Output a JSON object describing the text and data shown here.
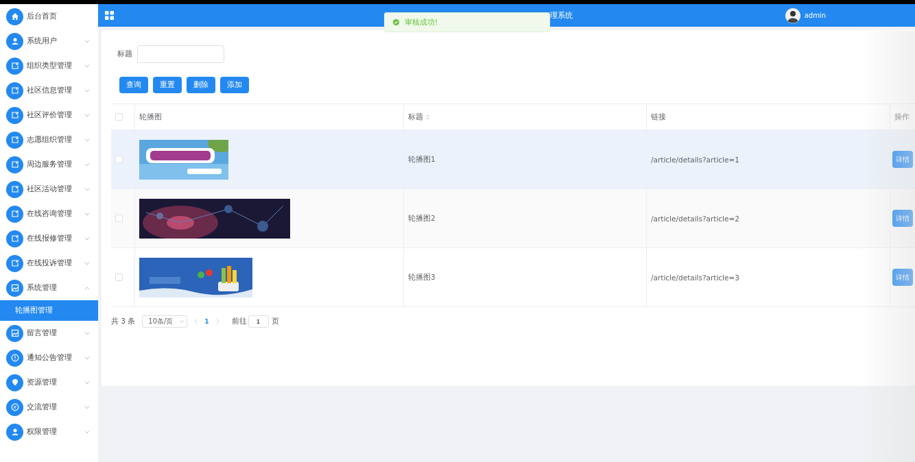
{
  "sidebar": {
    "items": [
      {
        "label": "后台首页",
        "kind": "link"
      },
      {
        "label": "系统用户",
        "kind": "submenu",
        "expanded": false
      },
      {
        "label": "组织类型管理",
        "kind": "submenu",
        "expanded": false
      },
      {
        "label": "社区信息管理",
        "kind": "submenu",
        "expanded": false
      },
      {
        "label": "社区评价管理",
        "kind": "submenu",
        "expanded": false
      },
      {
        "label": "志愿组织管理",
        "kind": "submenu",
        "expanded": false
      },
      {
        "label": "周边服务管理",
        "kind": "submenu",
        "expanded": false
      },
      {
        "label": "社区活动管理",
        "kind": "submenu",
        "expanded": false
      },
      {
        "label": "在线咨询管理",
        "kind": "submenu",
        "expanded": false
      },
      {
        "label": "在线报修管理",
        "kind": "submenu",
        "expanded": false
      },
      {
        "label": "在线投诉管理",
        "kind": "submenu",
        "expanded": false
      },
      {
        "label": "系统管理",
        "kind": "submenu",
        "expanded": true,
        "children": [
          {
            "label": "轮播图管理",
            "selected": true
          }
        ]
      },
      {
        "label": "留言管理",
        "kind": "submenu",
        "expanded": false
      },
      {
        "label": "通知公告管理",
        "kind": "submenu",
        "expanded": false
      },
      {
        "label": "资源管理",
        "kind": "submenu",
        "expanded": false
      },
      {
        "label": "交流管理",
        "kind": "submenu",
        "expanded": false
      },
      {
        "label": "权限管理",
        "kind": "submenu",
        "expanded": false
      }
    ]
  },
  "header": {
    "title": "理系统",
    "user": "admin"
  },
  "toast": {
    "message": "审核成功!"
  },
  "search": {
    "label": "标题"
  },
  "buttons": [
    "查询",
    "重置",
    "删除",
    "添加"
  ],
  "table": {
    "all_checked": false,
    "columns": [
      "轮播图",
      "标题",
      "链接",
      "操作"
    ],
    "rows": [
      {
        "checked": false,
        "hovered": true,
        "title": "轮播图1",
        "link": "/article/details?article=1",
        "action": "详情"
      },
      {
        "checked": false,
        "hovered": false,
        "title": "轮播图2",
        "link": "/article/details?article=2",
        "action": "详情"
      },
      {
        "checked": false,
        "hovered": false,
        "title": "轮播图3",
        "link": "/article/details?article=3",
        "action": "详情"
      }
    ]
  },
  "pagination": {
    "total": "共 3 条",
    "page_size": "10条/页",
    "pages": [
      {
        "label": "1",
        "selected": true
      }
    ],
    "goto_label": "前往",
    "goto_value": "1",
    "goto_suffix": "页"
  }
}
